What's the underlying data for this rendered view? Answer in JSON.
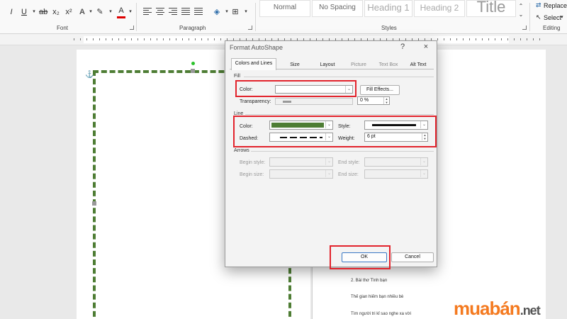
{
  "ribbon": {
    "font_buttons": [
      "I",
      "U",
      "ab",
      "x₂",
      "x²",
      "A",
      "A"
    ],
    "groups": {
      "font": "Font",
      "paragraph": "Paragraph",
      "styles": "Styles",
      "editing": "Editing"
    },
    "styles": [
      "Normal",
      "No Spacing",
      "Heading 1",
      "Heading 2",
      "Title"
    ],
    "editing": {
      "replace": "Replace",
      "select": "Select"
    }
  },
  "document": {
    "lines": [
      "2. Bài thơ Tình bạn",
      "Thế gian hiếm bạn nhiều bè",
      "Tìm người tri kỉ sao nghe xa vời"
    ]
  },
  "dialog": {
    "title": "Format AutoShape",
    "help": "?",
    "close": "×",
    "tabs": [
      "Colors and Lines",
      "Size",
      "Layout",
      "Picture",
      "Text Box",
      "Alt Text"
    ],
    "fill": {
      "section": "Fill",
      "color_label": "Color:",
      "color_value": "",
      "fill_effects": "Fill Effects...",
      "transparency_label": "Transparency:",
      "transparency_value": "0 %"
    },
    "line": {
      "section": "Line",
      "color_label": "Color:",
      "color_value": "#4e7d34",
      "dashed_label": "Dashed:",
      "style_label": "Style:",
      "weight_label": "Weight:",
      "weight_value": "6 pt"
    },
    "arrows": {
      "section": "Arrows",
      "begin_style": "Begin style:",
      "end_style": "End style:",
      "begin_size": "Begin size:",
      "end_size": "End size:"
    },
    "ok": "OK",
    "cancel": "Cancel"
  },
  "watermark": {
    "brand": "muabán",
    "tld": ".net"
  },
  "colors": {
    "accent": "#4e7d34",
    "highlight": "#e2232c",
    "brand": "#f47a20"
  }
}
